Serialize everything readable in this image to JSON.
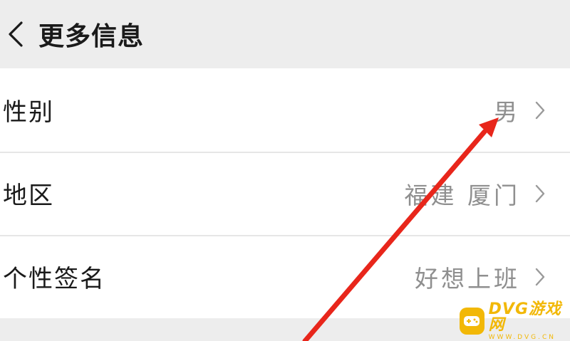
{
  "header": {
    "title": "更多信息",
    "back_icon": "chevron-left-icon"
  },
  "rows": [
    {
      "label": "性别",
      "value": "男",
      "chevron_icon": "chevron-right-icon"
    },
    {
      "label": "地区",
      "value": "福建 厦门",
      "chevron_icon": "chevron-right-icon"
    },
    {
      "label": "个性签名",
      "value": "好想上班",
      "chevron_icon": "chevron-right-icon"
    }
  ],
  "annotation": {
    "type": "arrow",
    "color": "#e8261b",
    "points_to": "性别 value"
  },
  "watermark": {
    "text": "DVG游戏网",
    "subtext": "WWW.DVG.CN",
    "color": "#f2b807",
    "icon": "gamepad-icon"
  },
  "colors": {
    "background": "#ededed",
    "card": "#ffffff",
    "text_primary": "#1a1a1a",
    "text_secondary": "#8f8f8f"
  }
}
